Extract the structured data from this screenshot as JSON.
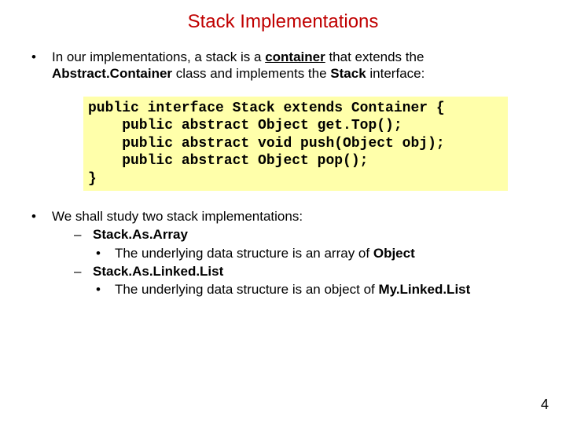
{
  "title": "Stack Implementations",
  "para1": {
    "pre": "In our implementations, a stack is a ",
    "container_word": "container",
    "mid1": " that extends the ",
    "class_name": "Abstract.Container",
    "mid2": " class and implements the ",
    "iface_name": "Stack",
    "post": " interface:"
  },
  "code": "public interface Stack extends Container {\n    public abstract Object get.Top();\n    public abstract void push(Object obj);\n    public abstract Object pop();\n}",
  "para2": {
    "lead": "We shall study two stack implementations:",
    "impl1": {
      "name": "Stack.As.Array",
      "desc_pre": "The underlying data structure is an array of ",
      "desc_bold": "Object"
    },
    "impl2": {
      "name": "Stack.As.Linked.List",
      "desc_pre": "The underlying data structure is an object of ",
      "desc_bold": "My.Linked.List"
    }
  },
  "page_number": "4"
}
